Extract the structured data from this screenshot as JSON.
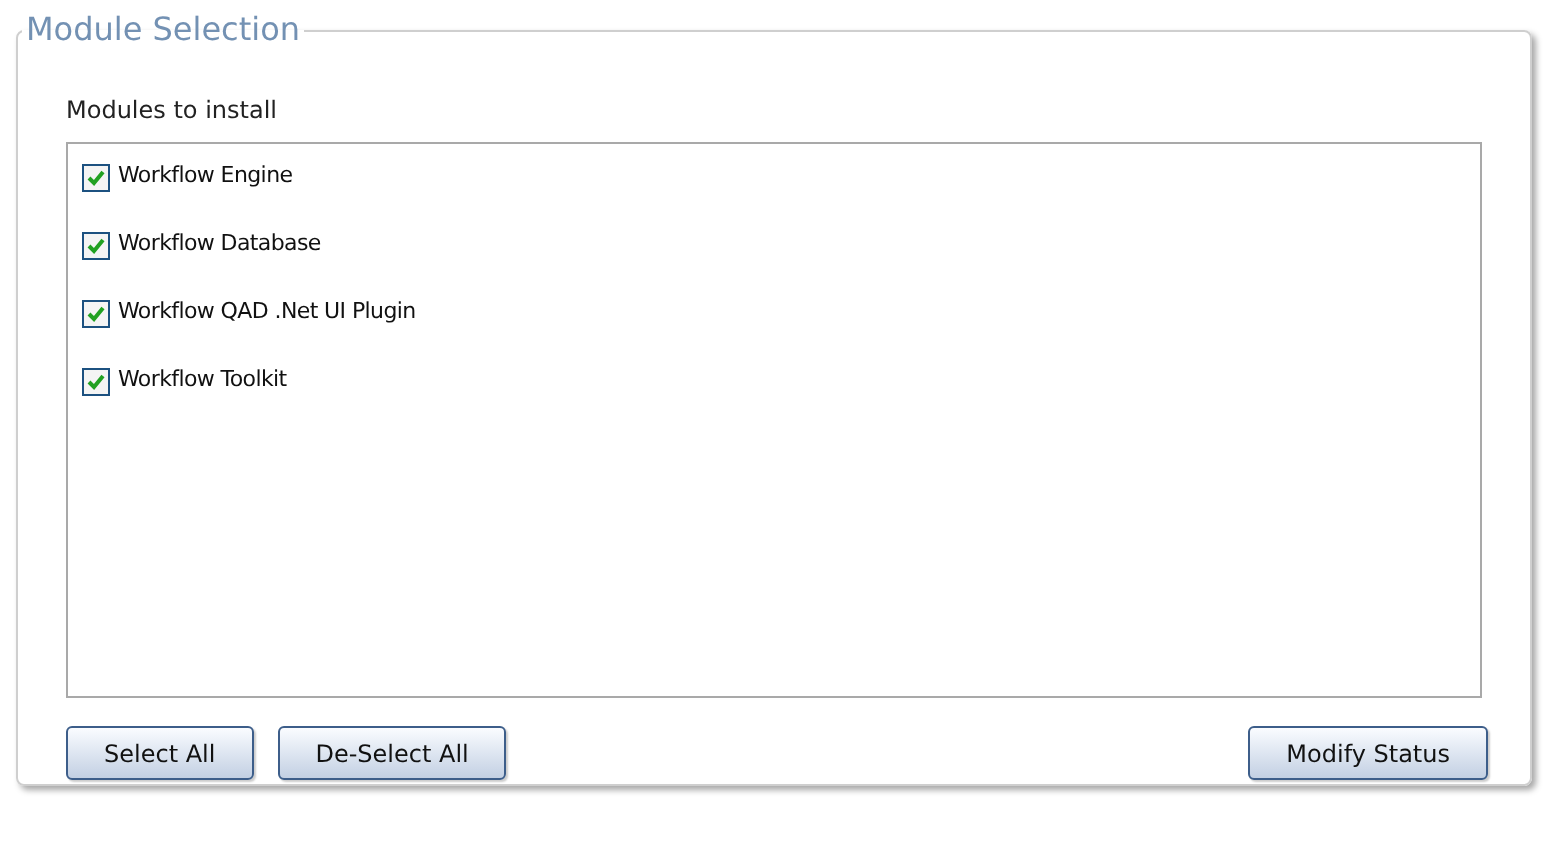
{
  "group": {
    "title": "Module Selection"
  },
  "list_label": "Modules to install",
  "modules": [
    {
      "label": "Workflow Engine",
      "checked": true
    },
    {
      "label": "Workflow Database",
      "checked": true
    },
    {
      "label": "Workflow QAD .Net UI Plugin",
      "checked": true
    },
    {
      "label": "Workflow Toolkit",
      "checked": true
    }
  ],
  "buttons": [
    {
      "label": "Select All",
      "kind": "left"
    },
    {
      "label": "De-Select All",
      "kind": "left"
    },
    {
      "label": "Modify Status",
      "kind": "right"
    }
  ]
}
